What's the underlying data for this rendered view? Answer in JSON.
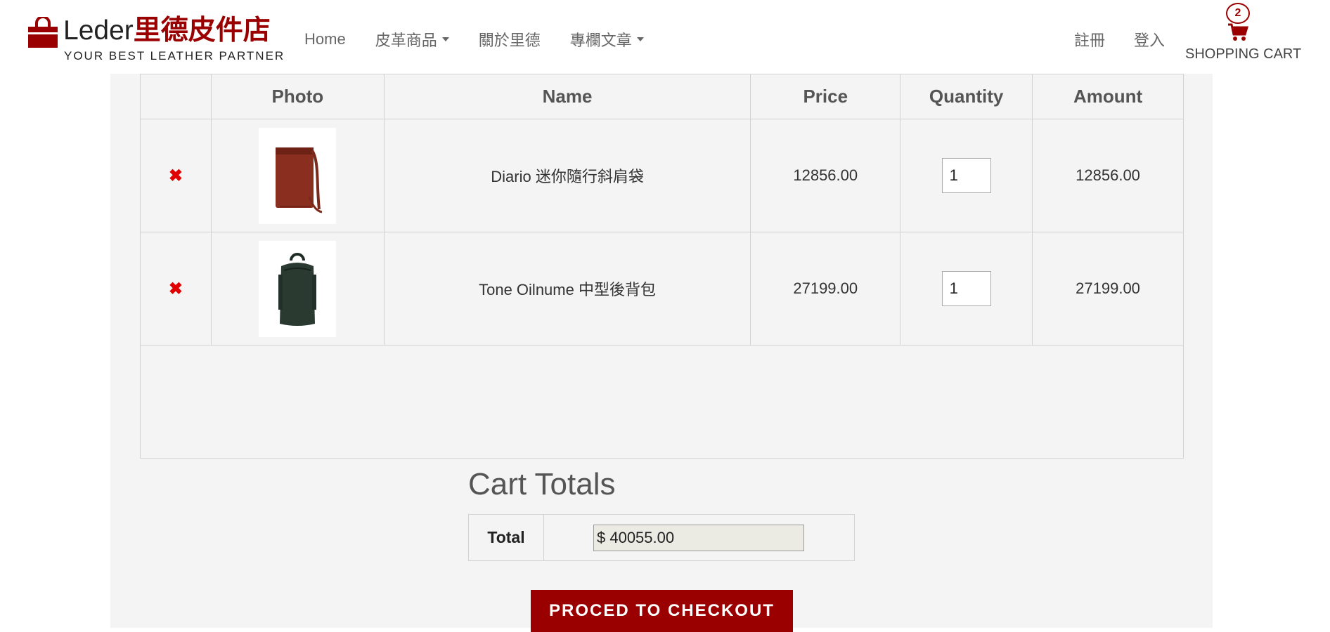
{
  "brand": {
    "name_latin": "Leder",
    "name_cjk": "里德皮件店",
    "tagline": "YOUR BEST LEATHER PARTNER",
    "accent_color": "#9b0000"
  },
  "nav": {
    "items": [
      {
        "label": "Home"
      },
      {
        "label": "皮革商品"
      },
      {
        "label": "關於里德"
      },
      {
        "label": "專欄文章"
      }
    ],
    "register": "註冊",
    "login": "登入"
  },
  "cart": {
    "count": "2",
    "label": "SHOPPING CART",
    "icon": "cart-icon"
  },
  "table": {
    "headers": [
      "",
      "Photo",
      "Name",
      "Price",
      "Quantity",
      "Amount"
    ],
    "rows": [
      {
        "remove": "✖",
        "photo": "brown-crossbody-bag",
        "name": "Diario 迷你隨行斜肩袋",
        "price": "12856.00",
        "quantity": "1",
        "amount": "12856.00"
      },
      {
        "remove": "✖",
        "photo": "dark-green-backpack",
        "name": "Tone Oilnume 中型後背包",
        "price": "27199.00",
        "quantity": "1",
        "amount": "27199.00"
      }
    ]
  },
  "totals": {
    "title": "Cart Totals",
    "label": "Total",
    "value": "$ 40055.00"
  },
  "checkout": {
    "label": "PROCED TO CHECKOUT"
  }
}
